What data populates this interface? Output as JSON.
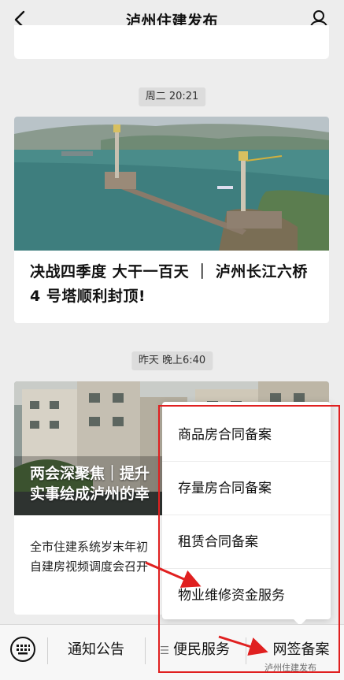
{
  "header": {
    "title": "泸州住建发布"
  },
  "timestamps": {
    "t1": "周二 20:21",
    "t2": "昨天 晚上6:40"
  },
  "articles": [
    {
      "title": "决战四季度 大干一百天 ｜ 泸州长江六桥 4 号塔顺利封顶!"
    },
    {
      "image_title_line1": "两会深聚焦｜提升",
      "image_title_line2": "实事绘成泸州的幸",
      "sub_line1": "全市住建系统岁末年初",
      "sub_line2": "自建房视频调度会召开"
    }
  ],
  "popup_menu": {
    "items": [
      "商品房合同备案",
      "存量房合同备案",
      "租赁合同备案",
      "物业维修资金服务"
    ]
  },
  "bottom_menu": {
    "items": [
      "通知公告",
      "便民服务",
      "网签备案"
    ]
  },
  "watermark": "泸州住建发布",
  "colors": {
    "annotation": "#e02020",
    "background": "#ededed"
  }
}
